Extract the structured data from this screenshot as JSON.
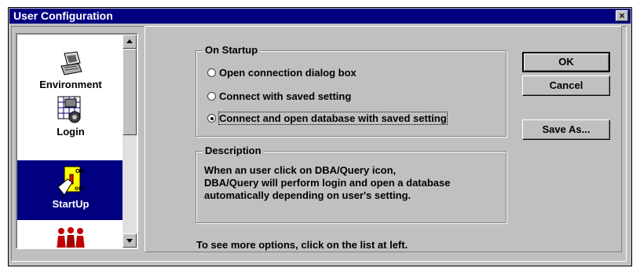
{
  "window": {
    "title": "User Configuration",
    "close_label": "×"
  },
  "list": {
    "items": [
      {
        "label": "Environment",
        "icon": "computer-icon"
      },
      {
        "label": "Login",
        "icon": "login-icon"
      },
      {
        "label": "StartUp",
        "icon": "startup-switch-icon",
        "selected": true
      },
      {
        "label": "",
        "icon": "users-group-icon"
      }
    ]
  },
  "on_startup": {
    "title": "On Startup",
    "options": [
      {
        "label": "Open connection dialog box",
        "checked": false
      },
      {
        "label": "Connect with saved setting",
        "checked": false
      },
      {
        "label": "Connect and open database with saved setting",
        "checked": true
      }
    ]
  },
  "description": {
    "title": "Description",
    "lines": [
      "When an user click on DBA/Query icon,",
      "DBA/Query will perform login and open a database",
      "automatically depending on user's setting."
    ]
  },
  "buttons": {
    "ok": "OK",
    "cancel": "Cancel",
    "save_as": "Save As..."
  },
  "hint": "To see more options, click on the list at left.",
  "colors": {
    "title_bar": "#000080",
    "face": "#c0c0c0",
    "selection": "#000080"
  }
}
